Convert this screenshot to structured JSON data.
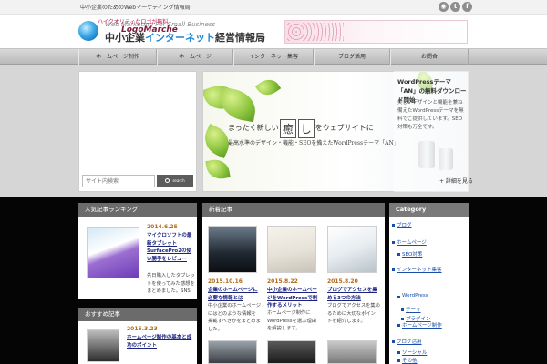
{
  "topbar": {
    "tagline": "中小企業のためのWebマーケティング情報局",
    "social_icons": [
      "rss-icon",
      "twitter-icon",
      "facebook-icon"
    ]
  },
  "header": {
    "logo_en": "Web Marketing For Small Business",
    "logo_jp_1": "中小企業",
    "logo_jp_2": "インターネット",
    "logo_jp_3": "経営情報局",
    "banner_text_1": "ハイクオリティなロゴが無料",
    "banner_text_2": "LogoMarché"
  },
  "nav": {
    "items": [
      "ホームページ制作",
      "ホームページ",
      "インターネット集客",
      "ブログ活用",
      "お問合"
    ]
  },
  "search": {
    "placeholder": "サイト内検索",
    "button_label": "search"
  },
  "slider": {
    "copy_pre": "まったく新しい",
    "copy_heal": "癒",
    "copy_shi": "し",
    "copy_post": "をウェブサイトに",
    "copy_sub": "最高水準のデザイン・機能・SEOを備えたWordPressテーマ「AN」",
    "caption_title": "WordPressテーマ「AN」の無料ダウンロード開始",
    "caption_body": "美しいデザインと機能を兼ね備えたWordPressテーマを無料でご提供しています。SEO対策も万全です。",
    "more": "+ 詳細を見る"
  },
  "colors": {
    "box_header": "#6b6b6b",
    "date": "#b06a1a",
    "link": "#1a237e",
    "accent_blue": "#1d86d4",
    "category_header": "#7a7a7a"
  },
  "popular": {
    "header": "人気記事ランキング",
    "date": "2014.6.25",
    "title": "マイクロソフトの最新タブレットSurfacePro2の使い勝手をレビュー",
    "excerpt": "先日購入したタブレットを使ってみた感想をまとめました。SNSやブログの更新、ホームページのチェックに..."
  },
  "recommended": {
    "header": "おすすめ記事",
    "date": "2015.3.23",
    "title": "ホームページ制作の基本と成功のポイント"
  },
  "new_posts": {
    "header": "新着記事",
    "posts": [
      {
        "date": "2015.10.16",
        "title": "企業のホームページに必要な情報とは",
        "excerpt": "中小企業のホームページにはどのような情報を掲載すべきかをまとめました。"
      },
      {
        "date": "2015.8.22",
        "title": "中小企業のホームページをWordPressで制作するメリット",
        "excerpt": "ホームページ制作にWordPressを選ぶ理由を解説します。"
      },
      {
        "date": "2015.8.20",
        "title": "ブログでアクセスを集める3つの方法",
        "excerpt": "ブログでアクセスを集めるために大切なポイントを紹介します。"
      }
    ]
  },
  "categories": {
    "header": "Category",
    "items": [
      "ブログ",
      "ホームページ",
      "SEO対策",
      "インターネット集客",
      "WordPress",
      "テーマ",
      "プラグイン",
      "ホームページ制作",
      "ブログ活用",
      "ソーシャル",
      "その他"
    ]
  }
}
